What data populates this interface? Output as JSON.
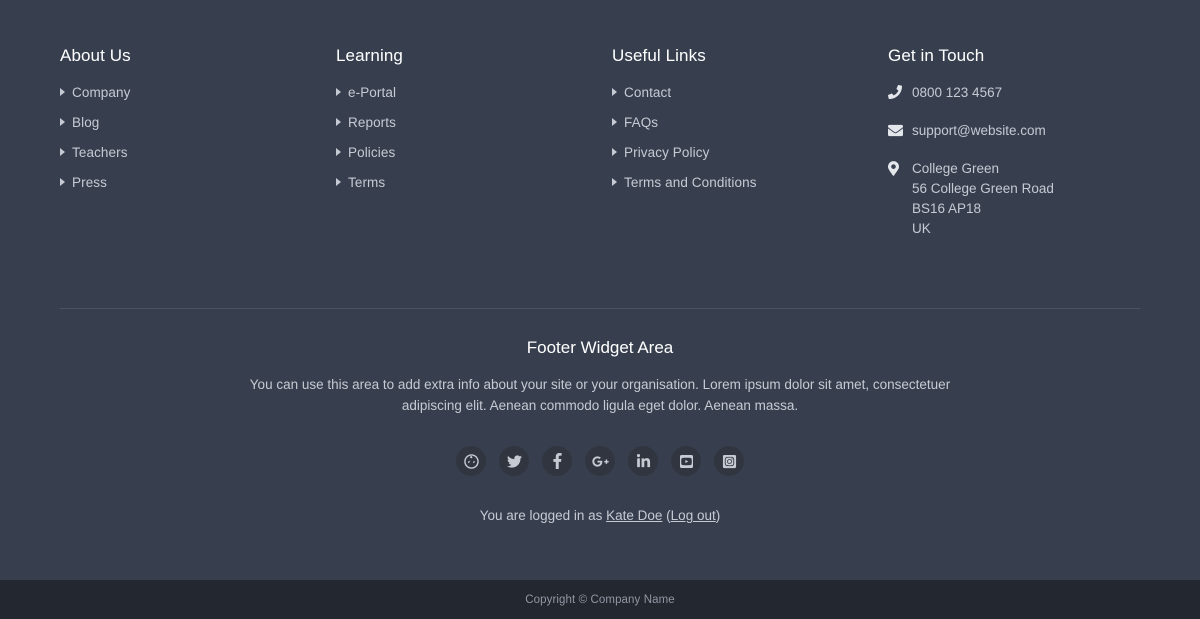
{
  "footer": {
    "columns": [
      {
        "title": "About Us",
        "links": [
          {
            "label": "Company"
          },
          {
            "label": "Blog"
          },
          {
            "label": "Teachers"
          },
          {
            "label": "Press"
          }
        ]
      },
      {
        "title": "Learning",
        "links": [
          {
            "label": "e-Portal"
          },
          {
            "label": "Reports"
          },
          {
            "label": "Policies"
          },
          {
            "label": "Terms"
          }
        ]
      },
      {
        "title": "Useful Links",
        "links": [
          {
            "label": "Contact"
          },
          {
            "label": "FAQs"
          },
          {
            "label": "Privacy Policy"
          },
          {
            "label": "Terms and Conditions"
          }
        ]
      }
    ],
    "contact": {
      "title": "Get in Touch",
      "phone_icon": "phone-icon",
      "phone": "0800 123 4567",
      "email_icon": "envelope-icon",
      "email": "support@website.com",
      "address_icon": "map-pin-icon",
      "address": [
        "College Green",
        "56 College Green Road",
        "BS16 AP18",
        "UK"
      ]
    },
    "widget": {
      "title": "Footer Widget Area",
      "text": "You can use this area to add extra info about your site or your organisation. Lorem ipsum dolor sit amet, consectetuer adipiscing elit. Aenean commodo ligula eget dolor. Aenean massa."
    },
    "social": [
      {
        "name": "globe-icon",
        "label": "Website"
      },
      {
        "name": "twitter-icon",
        "label": "Twitter"
      },
      {
        "name": "facebook-icon",
        "label": "Facebook"
      },
      {
        "name": "google-plus-icon",
        "label": "Google Plus"
      },
      {
        "name": "linkedin-icon",
        "label": "LinkedIn"
      },
      {
        "name": "youtube-icon",
        "label": "YouTube"
      },
      {
        "name": "instagram-icon",
        "label": "Instagram"
      }
    ],
    "session": {
      "prefix": "You are logged in as ",
      "user_name": "Kate Doe",
      "open_paren": " (",
      "logout_label": "Log out",
      "close_paren": ")"
    },
    "copyright": "Copyright © Company Name"
  },
  "colors": {
    "footer_background": "#373f4f",
    "copyright_background": "#23272f",
    "heading_text": "#ffffff",
    "body_text": "#c5cad3",
    "divider": "#4a5264",
    "social_circle": "#31353f",
    "copyright_text": "#9097a3"
  }
}
